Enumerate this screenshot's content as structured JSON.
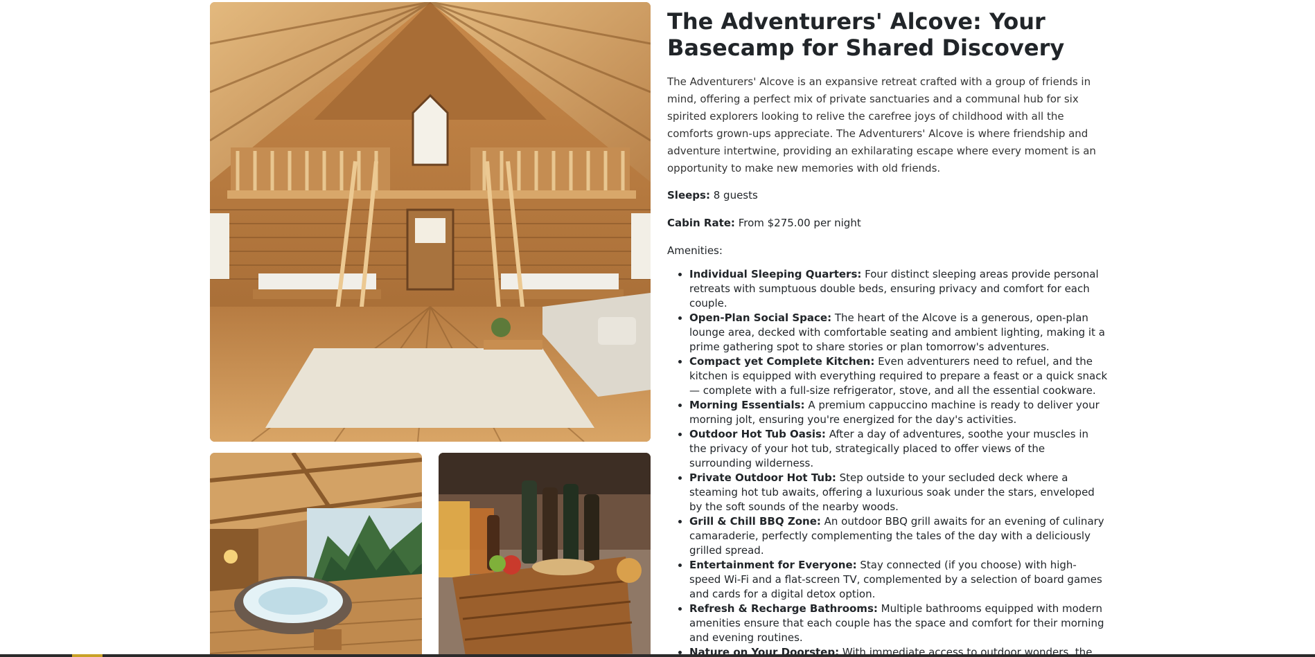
{
  "listing": {
    "title": "The Adventurers' Alcove: Your Basecamp for Shared Discovery",
    "description": "The Adventurers' Alcove is an expansive retreat crafted with a group of friends in mind, offering a perfect mix of private sanctuaries and a communal hub for six spirited explorers looking to relive the carefree joys of childhood with all the comforts grown-ups appreciate. The Adventurers' Alcove is where friendship and adventure intertwine, providing an exhilarating escape where every moment is an opportunity to make new memories with old friends.",
    "sleeps_label": "Sleeps:",
    "sleeps_value": " 8 guests",
    "rate_label": "Cabin Rate:",
    "rate_value": " From $275.00 per night",
    "amenities_title": "Amenities:",
    "amenities": [
      {
        "name": "Individual Sleeping Quarters:",
        "text": " Four distinct sleeping areas provide personal retreats with sumptuous double beds, ensuring privacy and comfort for each couple."
      },
      {
        "name": "Open-Plan Social Space:",
        "text": " The heart of the Alcove is a generous, open-plan lounge area, decked with comfortable seating and ambient lighting, making it a prime gathering spot to share stories or plan tomorrow's adventures."
      },
      {
        "name": "Compact yet Complete Kitchen:",
        "text": " Even adventurers need to refuel, and the kitchen is equipped with everything required to prepare a feast or a quick snack — complete with a full-size refrigerator, stove, and all the essential cookware."
      },
      {
        "name": "Morning Essentials:",
        "text": " A premium cappuccino machine is ready to deliver your morning jolt, ensuring you're energized for the day's activities."
      },
      {
        "name": "Outdoor Hot Tub Oasis:",
        "text": " After a day of adventures, soothe your muscles in the privacy of your hot tub, strategically placed to offer views of the surrounding wilderness."
      },
      {
        "name": "Private Outdoor Hot Tub:",
        "text": " Step outside to your secluded deck where a steaming hot tub awaits, offering a luxurious soak under the stars, enveloped by the soft sounds of the nearby woods."
      },
      {
        "name": "Grill & Chill BBQ Zone:",
        "text": " An outdoor BBQ grill awaits for an evening of culinary camaraderie, perfectly complementing the tales of the day with a deliciously grilled spread."
      },
      {
        "name": "Entertainment for Everyone:",
        "text": " Stay connected (if you choose) with high-speed Wi-Fi and a flat-screen TV, complemented by a selection of board games and cards for a digital detox option."
      },
      {
        "name": "Refresh & Recharge Bathrooms:",
        "text": " Multiple bathrooms equipped with modern amenities ensure that each couple has the space and comfort for their morning and evening routines."
      },
      {
        "name": "Nature on Your Doorstep:",
        "text": " With immediate access to outdoor wonders, the lodge comes with a guide to local trails, a star map for night-time viewing, and even a"
      }
    ]
  },
  "colors": {
    "wood_light": "#d9a86a",
    "wood_mid": "#b57a3e",
    "wood_dark": "#7a4a22",
    "text": "#212529"
  }
}
